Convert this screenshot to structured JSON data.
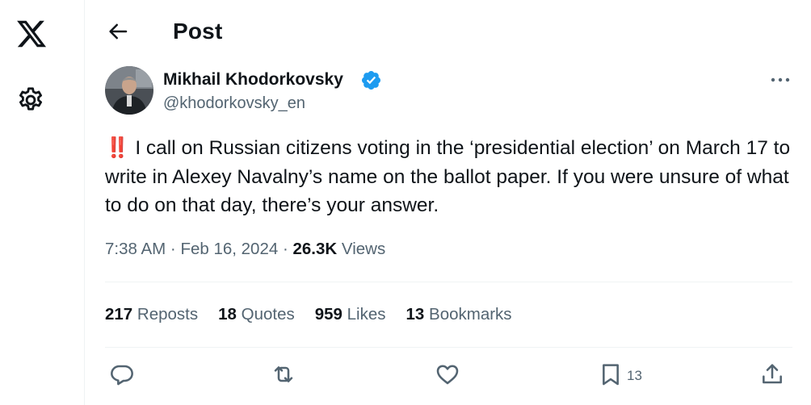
{
  "nav": {
    "logo_icon": "x-logo-icon",
    "settings_icon": "gear-icon"
  },
  "header": {
    "back_icon": "arrow-left-icon",
    "title": "Post"
  },
  "author": {
    "display_name": "Mikhail Khodorkovsky",
    "handle": "@khodorkovsky_en",
    "verified_icon": "verified-badge-icon",
    "verified_color": "#1d9bf0"
  },
  "more_icon": "more-horizontal-icon",
  "post": {
    "emoji": "‼️",
    "text": " I call on Russian citizens voting in the ‘presidential election’ on March 17 to write in Alexey Navalny’s name on the ballot paper. If you were unsure of what to do on that day, there’s your answer.",
    "time": "7:38 AM",
    "separator": " · ",
    "date": "Feb 16, 2024",
    "views_count": "26.3K",
    "views_label": " Views"
  },
  "stats": {
    "reposts_count": "217",
    "reposts_label": " Reposts",
    "quotes_count": "18",
    "quotes_label": " Quotes",
    "likes_count": "959",
    "likes_label": " Likes",
    "bookmarks_count": "13",
    "bookmarks_label": " Bookmarks"
  },
  "actions": {
    "reply_icon": "reply-icon",
    "repost_icon": "repost-icon",
    "like_icon": "heart-icon",
    "bookmark_icon": "bookmark-icon",
    "bookmark_count": "13",
    "share_icon": "share-icon"
  },
  "colors": {
    "text": "#0f1419",
    "secondary": "#536471",
    "divider": "#eff3f4",
    "accent": "#1d9bf0"
  }
}
